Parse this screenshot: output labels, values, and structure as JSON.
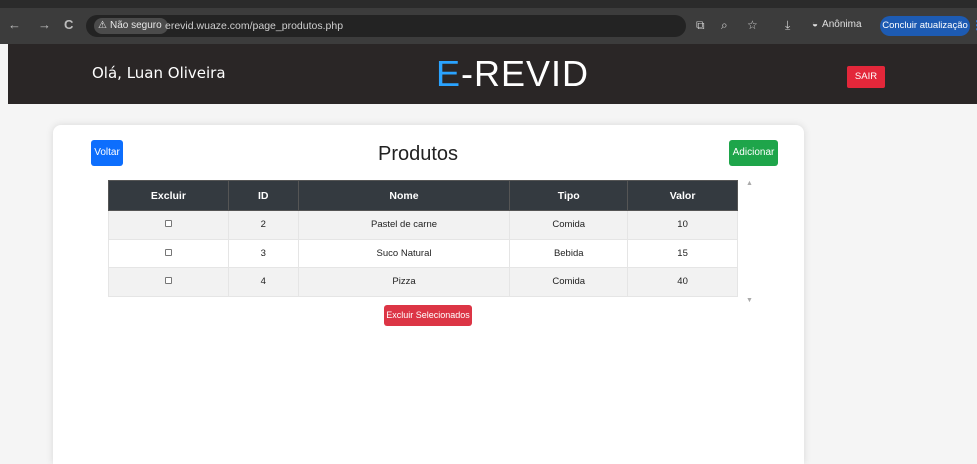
{
  "browser": {
    "back_icon": "←",
    "forward_icon": "→",
    "reload_icon": "C",
    "security_label": "Não seguro",
    "url": "erevid.wuaze.com/page_produtos.php",
    "incognito_label": "Anônima",
    "update_label": "Concluir atualização"
  },
  "header": {
    "greeting": "Olá, Luan Oliveira",
    "logo_prefix": "E",
    "logo_rest": "-REVID",
    "logout_label": "SAIR"
  },
  "card": {
    "back_label": "Voltar",
    "title": "Produtos",
    "add_label": "Adicionar"
  },
  "table": {
    "headers": [
      "Excluir",
      "ID",
      "Nome",
      "Tipo",
      "Valor"
    ],
    "rows": [
      {
        "id": "2",
        "nome": "Pastel de carne",
        "tipo": "Comida",
        "valor": "10"
      },
      {
        "id": "3",
        "nome": "Suco Natural",
        "tipo": "Bebida",
        "valor": "15"
      },
      {
        "id": "4",
        "nome": "Pizza",
        "tipo": "Comida",
        "valor": "40"
      }
    ]
  },
  "delete_selected_label": "Excluir Selecionados"
}
